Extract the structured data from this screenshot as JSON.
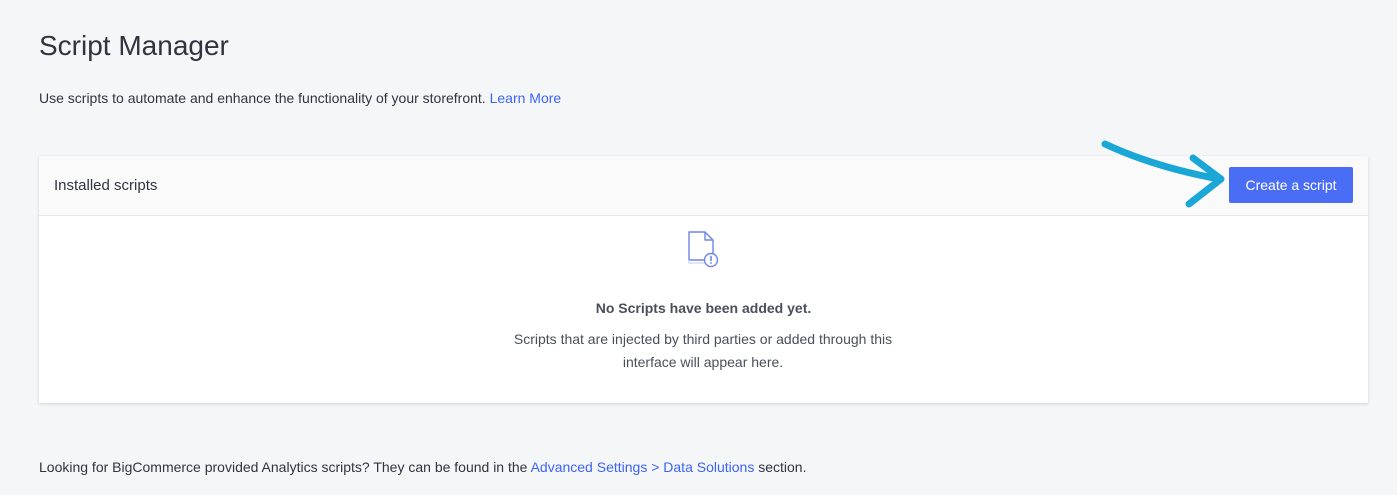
{
  "page": {
    "title": "Script Manager",
    "intro_text": "Use scripts to automate and enhance the functionality of your storefront.",
    "learn_more_label": "Learn More"
  },
  "panel": {
    "title": "Installed scripts",
    "create_button_label": "Create a script",
    "empty_state": {
      "icon": "document-alert-icon",
      "title": "No Scripts have been added yet.",
      "description": "Scripts that are injected by third parties or added through this interface will appear here."
    }
  },
  "footer": {
    "text_before": "Looking for BigCommerce provided Analytics scripts? They can be found in the",
    "link_label": "Advanced Settings > Data Solutions",
    "text_after": "section."
  },
  "annotation": {
    "icon": "arrow-annotation",
    "color": "#1aa7d6"
  },
  "colors": {
    "background": "#f5f6f8",
    "primary_button": "#4a6df5",
    "link": "#3c64f4",
    "text": "#313440"
  }
}
